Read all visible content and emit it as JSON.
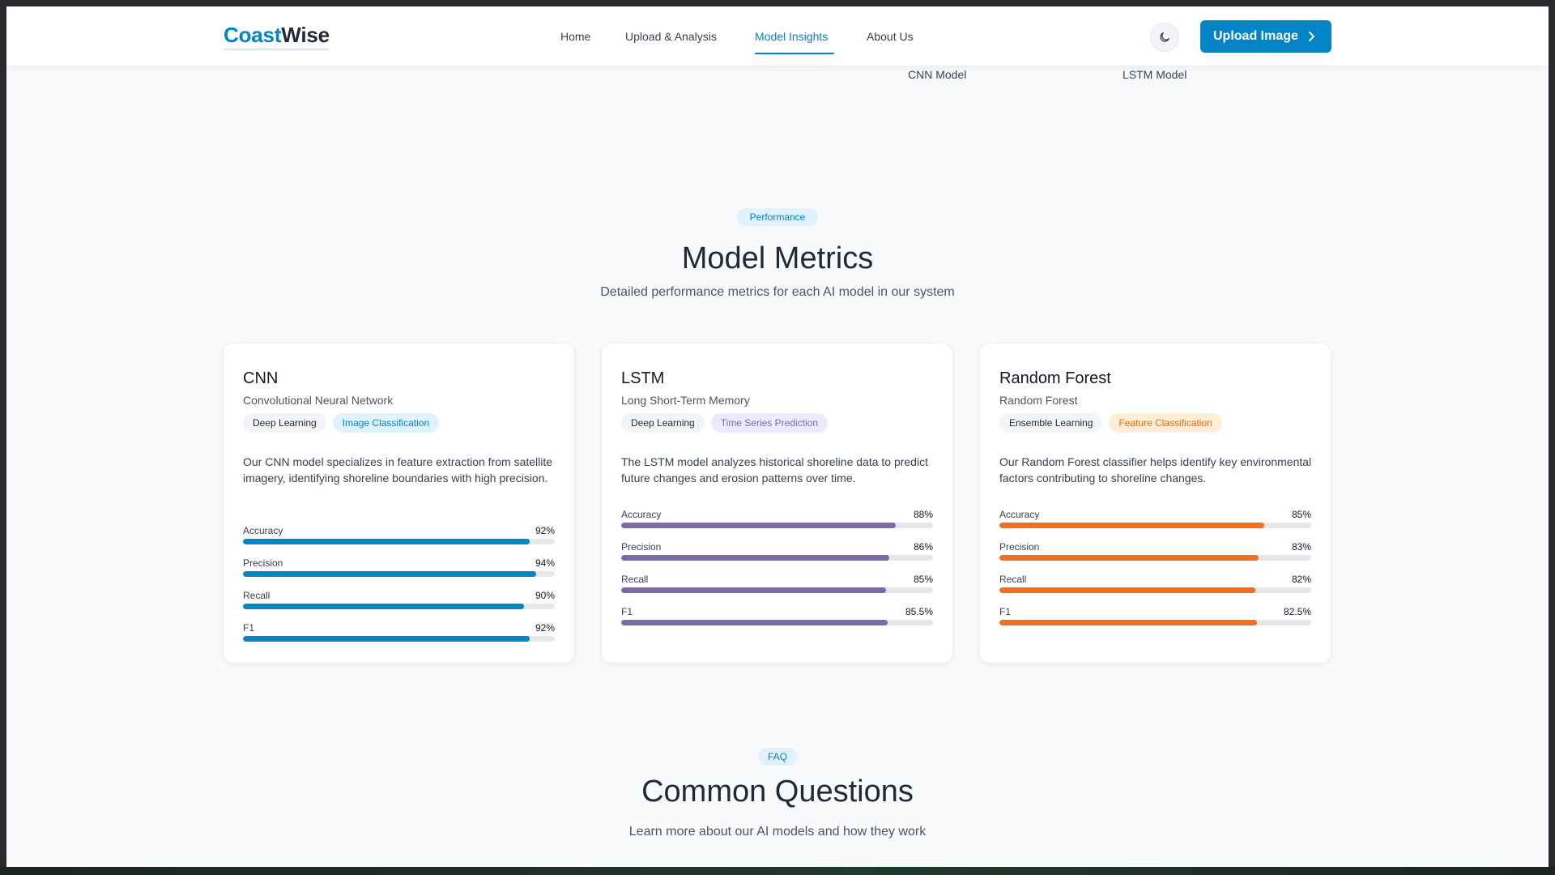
{
  "colors": {
    "brand": "#0284c7",
    "cnn": "#0284c7",
    "lstm": "#7c6aa8",
    "rf": "#f07020"
  },
  "header": {
    "logo_part1": "Coast",
    "logo_part2": "Wise",
    "nav": [
      {
        "label": "Home",
        "active": false
      },
      {
        "label": "Upload & Analysis",
        "active": false
      },
      {
        "label": "Model Insights",
        "active": true
      },
      {
        "label": "About Us",
        "active": false
      }
    ],
    "theme_icon": "moon-icon",
    "upload_label": "Upload Image",
    "upload_icon": "chevron-right-icon"
  },
  "prev_section": {
    "labels": [
      "CNN Model",
      "LSTM Model"
    ]
  },
  "metrics_section": {
    "pill": "Performance",
    "title": "Model Metrics",
    "subtitle": "Detailed performance metrics for each AI model in our system",
    "cards": [
      {
        "title": "CNN",
        "subtitle": "Convolutional Neural Network",
        "tags": [
          "Deep Learning",
          "Image Classification"
        ],
        "description": "Our CNN model specializes in feature extraction from satellite imagery, identifying shoreline boundaries with high precision.",
        "metrics": [
          {
            "label": "Accuracy",
            "value": "92%",
            "fraction": 0.92
          },
          {
            "label": "Precision",
            "value": "94%",
            "fraction": 0.94
          },
          {
            "label": "Recall",
            "value": "90%",
            "fraction": 0.9
          },
          {
            "label": "F1",
            "value": "92%",
            "fraction": 0.92
          }
        ]
      },
      {
        "title": "LSTM",
        "subtitle": "Long Short-Term Memory",
        "tags": [
          "Deep Learning",
          "Time Series Prediction"
        ],
        "description": "The LSTM model analyzes historical shoreline data to predict future changes and erosion patterns over time.",
        "metrics": [
          {
            "label": "Accuracy",
            "value": "88%",
            "fraction": 0.88
          },
          {
            "label": "Precision",
            "value": "86%",
            "fraction": 0.86
          },
          {
            "label": "Recall",
            "value": "85%",
            "fraction": 0.85
          },
          {
            "label": "F1",
            "value": "85.5%",
            "fraction": 0.855
          }
        ]
      },
      {
        "title": "Random Forest",
        "subtitle": "Random Forest",
        "tags": [
          "Ensemble Learning",
          "Feature Classification"
        ],
        "description": "Our Random Forest classifier helps identify key environmental factors contributing to shoreline changes.",
        "metrics": [
          {
            "label": "Accuracy",
            "value": "85%",
            "fraction": 0.85
          },
          {
            "label": "Precision",
            "value": "83%",
            "fraction": 0.83
          },
          {
            "label": "Recall",
            "value": "82%",
            "fraction": 0.82
          },
          {
            "label": "F1",
            "value": "82.5%",
            "fraction": 0.825
          }
        ]
      }
    ]
  },
  "faq_section": {
    "pill": "FAQ",
    "title": "Common Questions",
    "subtitle": "Learn more about our AI models and how they work"
  }
}
